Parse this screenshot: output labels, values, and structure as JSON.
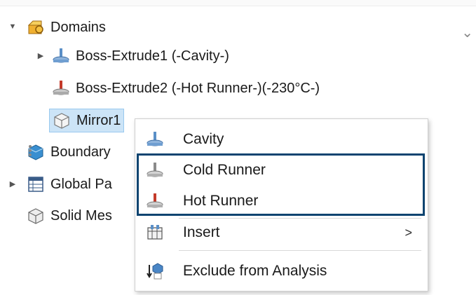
{
  "tree": {
    "domains_label": "Domains",
    "items": [
      {
        "label": "Boss-Extrude1 (-Cavity-)"
      },
      {
        "label": "Boss-Extrude2 (-Hot Runner-)(-230°C-)"
      },
      {
        "label": "Mirror1"
      }
    ],
    "boundary_label": "Boundary",
    "global_label": "Global Pa",
    "solid_mesh_label": "Solid Mes"
  },
  "context_menu": {
    "items": [
      {
        "label": "Cavity",
        "icon": "cavity-icon"
      },
      {
        "label": "Cold Runner",
        "icon": "cold-runner-icon"
      },
      {
        "label": "Hot Runner",
        "icon": "hot-runner-icon"
      },
      {
        "label": "Insert",
        "icon": "insert-icon",
        "submenu": ">"
      },
      {
        "label": "Exclude from Analysis",
        "icon": "exclude-icon"
      }
    ]
  },
  "colors": {
    "highlight_border": "#0d4470",
    "selection_bg": "#cce4f7",
    "cavity_blue": "#5a8fc7",
    "hot_red": "#c43a2a"
  }
}
